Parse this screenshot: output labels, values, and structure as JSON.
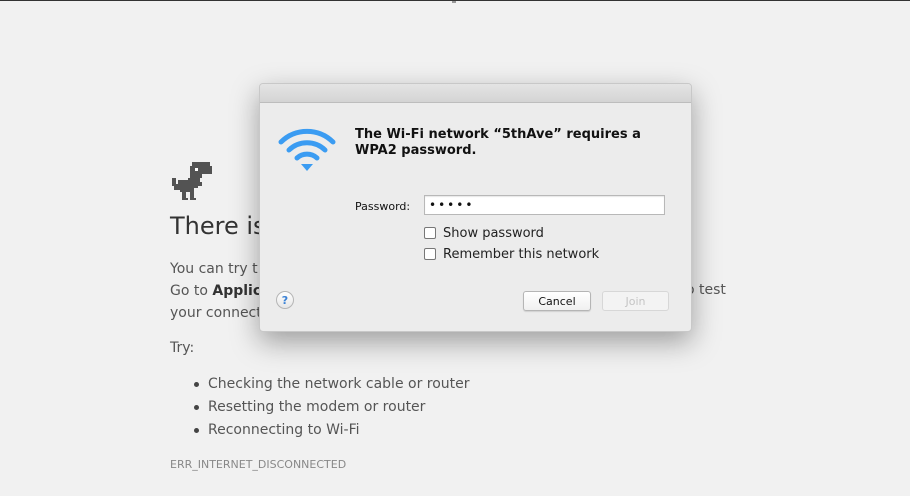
{
  "background_page": {
    "heading": "There is",
    "lines": [
      {
        "text": "You can try t"
      },
      {
        "prefix": "Go to ",
        "bold": "Applic"
      },
      {
        "text": "your connect"
      }
    ],
    "right_fragment": "o test",
    "try_label": "Try:",
    "suggestions": [
      "Checking the network cable or router",
      "Resetting the modem or router",
      "Reconnecting to Wi-Fi"
    ],
    "error_code": "ERR_INTERNET_DISCONNECTED"
  },
  "dialog": {
    "message": "The Wi-Fi network “5thAve” requires a WPA2 password.",
    "password_label": "Password:",
    "password_value": "•••••",
    "show_password_label": "Show password",
    "remember_network_label": "Remember this network",
    "help_label": "?",
    "cancel_label": "Cancel",
    "join_label": "Join",
    "accent_color": "#3b9cf2",
    "icon": "wifi-icon"
  }
}
